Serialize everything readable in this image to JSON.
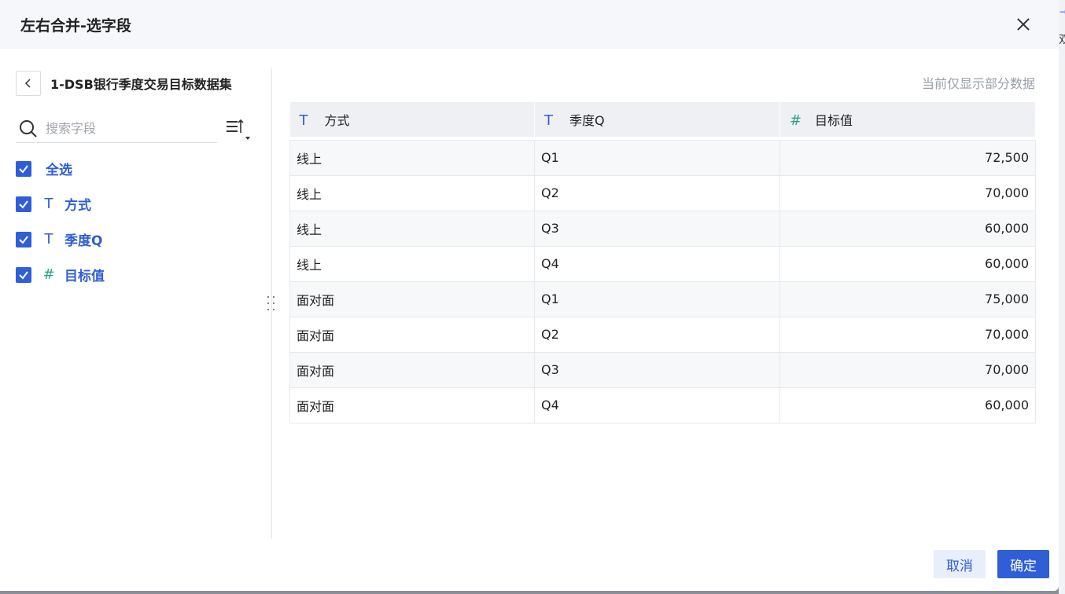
{
  "dialog": {
    "title": "左右合并-选字段"
  },
  "left_panel": {
    "dataset_name": "1-DSB银行季度交易目标数据集",
    "search_placeholder": "搜索字段",
    "select_all_label": "全选",
    "fields": [
      {
        "label": "方式",
        "type": "text",
        "icon": "text-type-icon",
        "checked": true
      },
      {
        "label": "季度Q",
        "type": "text",
        "icon": "text-type-icon",
        "checked": true
      },
      {
        "label": "目标值",
        "type": "number",
        "icon": "number-type-icon",
        "checked": true
      }
    ],
    "glyphs": {
      "text": "T",
      "number": "#"
    }
  },
  "preview": {
    "hint": "当前仅显示部分数据",
    "columns": [
      {
        "label": "方式",
        "type": "text"
      },
      {
        "label": "季度Q",
        "type": "text"
      },
      {
        "label": "目标值",
        "type": "number"
      }
    ],
    "rows": [
      [
        "线上",
        "Q1",
        "72,500"
      ],
      [
        "线上",
        "Q2",
        "70,000"
      ],
      [
        "线上",
        "Q3",
        "60,000"
      ],
      [
        "线上",
        "Q4",
        "60,000"
      ],
      [
        "面对面",
        "Q1",
        "75,000"
      ],
      [
        "面对面",
        "Q2",
        "70,000"
      ],
      [
        "面对面",
        "Q3",
        "70,000"
      ],
      [
        "面对面",
        "Q4",
        "60,000"
      ]
    ]
  },
  "footer": {
    "cancel_label": "取消",
    "ok_label": "确定"
  },
  "colors": {
    "accent": "#2f5ed6",
    "number_icon": "#2aa58a",
    "header_bg": "#f5f7fa"
  },
  "backdrop": {
    "edge_text": "双"
  }
}
